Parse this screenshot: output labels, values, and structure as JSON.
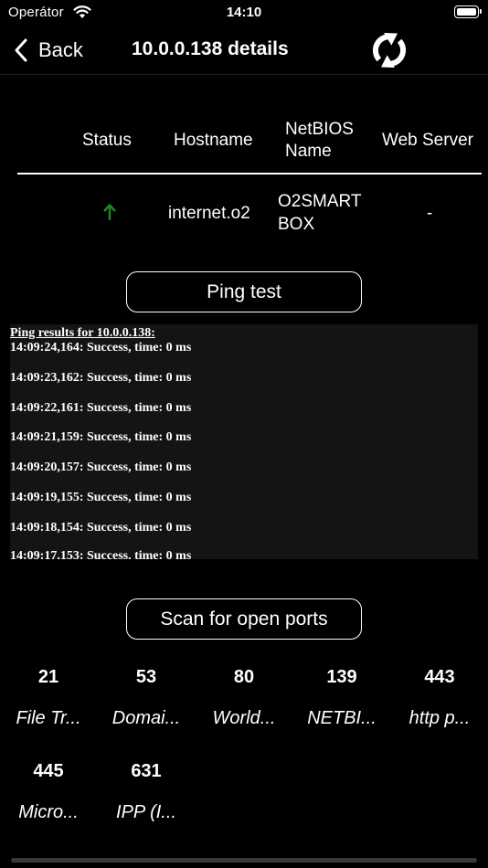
{
  "statusbar": {
    "carrier": "Operátor",
    "time": "14:10"
  },
  "nav": {
    "back_label": "Back",
    "title": "10.0.0.138 details"
  },
  "table": {
    "headers": {
      "status": "Status",
      "hostname": "Hostname",
      "netbios_1": "NetBIOS",
      "netbios_2": "Name",
      "web_server": "Web Server"
    },
    "row": {
      "status": "up",
      "hostname": "internet.o2",
      "netbios_1": "O2SMART",
      "netbios_2": "BOX",
      "web_server": "-"
    }
  },
  "ping": {
    "button_label": "Ping test",
    "title": "Ping results for 10.0.0.138:",
    "lines": [
      "14:09:24,164: Success, time: 0 ms",
      "14:09:23,162: Success, time: 0 ms",
      "14:09:22,161: Success, time: 0 ms",
      "14:09:21,159: Success, time: 0 ms",
      "14:09:20,157: Success, time: 0 ms",
      "14:09:19,155: Success, time: 0 ms",
      "14:09:18,154: Success, time: 0 ms",
      "14:09:17,153: Success, time: 0 ms"
    ]
  },
  "ports": {
    "button_label": "Scan for open ports",
    "items": [
      {
        "port": "21",
        "desc": "File Tr..."
      },
      {
        "port": "53",
        "desc": "Domai..."
      },
      {
        "port": "80",
        "desc": "World..."
      },
      {
        "port": "139",
        "desc": "NETBI..."
      },
      {
        "port": "443",
        "desc": "http p..."
      },
      {
        "port": "445",
        "desc": "Micro..."
      },
      {
        "port": "631",
        "desc": "IPP (I..."
      }
    ]
  },
  "colors": {
    "status_up": "#1f8a1f",
    "background": "#000000",
    "ping_box": "#141414"
  }
}
